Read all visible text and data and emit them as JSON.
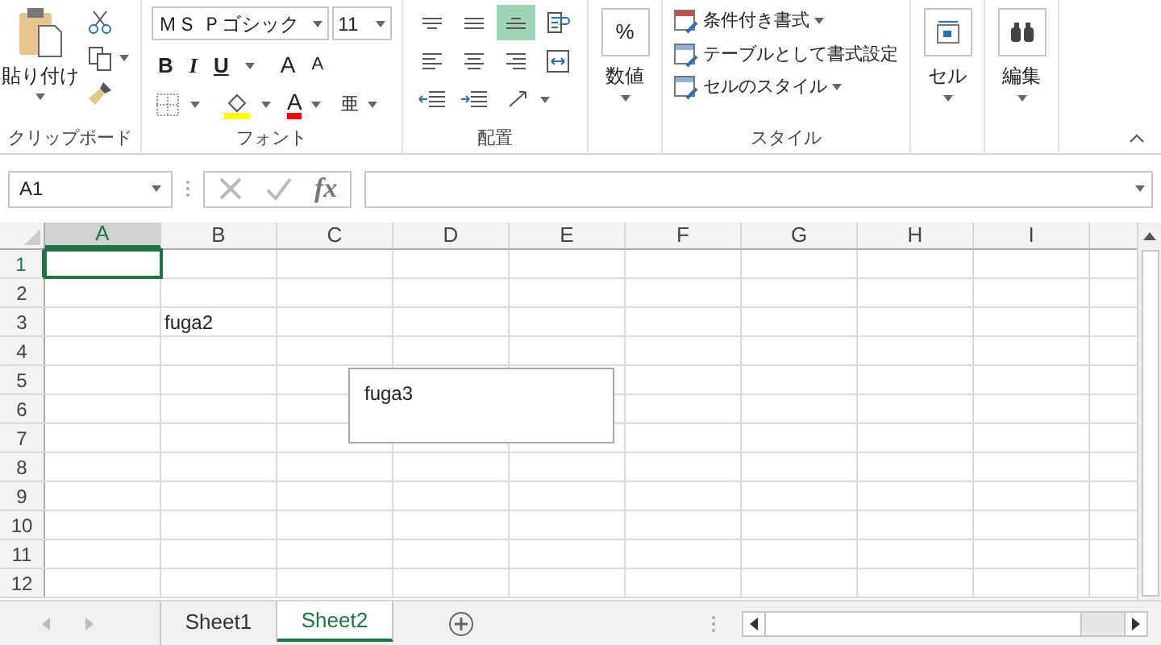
{
  "ribbon": {
    "clipboard": {
      "paste_label": "貼り付け",
      "group_label": "クリップボード"
    },
    "font": {
      "font_name": "ＭＳ Ｐゴシック",
      "font_size": "11",
      "bold": "B",
      "italic": "I",
      "underline": "U",
      "grow": "A",
      "shrink": "A",
      "font_color": "A",
      "phonetic": "亜",
      "group_label": "フォント"
    },
    "alignment": {
      "buttons": [
        {
          "kind": "top",
          "selected": false
        },
        {
          "kind": "middle",
          "selected": false
        },
        {
          "kind": "bottom",
          "selected": true
        },
        {
          "kind": "wrap",
          "selected": false
        },
        {
          "kind": "left",
          "selected": false
        },
        {
          "kind": "center",
          "selected": false
        },
        {
          "kind": "right",
          "selected": false
        },
        {
          "kind": "merge",
          "selected": false
        }
      ],
      "group_label": "配置"
    },
    "number": {
      "symbol": "%",
      "label": "数値"
    },
    "styles": {
      "items": [
        {
          "kind": "conditional",
          "label": "条件付き書式"
        },
        {
          "kind": "table",
          "label": "テーブルとして書式設定"
        },
        {
          "kind": "cell",
          "label": "セルのスタイル"
        }
      ],
      "group_label": "スタイル"
    },
    "cells": {
      "label": "セル"
    },
    "editing": {
      "label": "編集"
    }
  },
  "name_box": {
    "value": "A1"
  },
  "formula_bar": {
    "fx": "fx"
  },
  "columns": [
    {
      "label": "A",
      "selected": true
    },
    {
      "label": "B",
      "selected": false
    },
    {
      "label": "C",
      "selected": false
    },
    {
      "label": "D",
      "selected": false
    },
    {
      "label": "E",
      "selected": false
    },
    {
      "label": "F",
      "selected": false
    },
    {
      "label": "G",
      "selected": false
    },
    {
      "label": "H",
      "selected": false
    },
    {
      "label": "I",
      "selected": false
    }
  ],
  "rows": [
    {
      "label": "1",
      "selected": true
    },
    {
      "label": "2",
      "selected": false
    },
    {
      "label": "3",
      "selected": false,
      "cells": {
        "B": "fuga2"
      }
    },
    {
      "label": "4",
      "selected": false
    },
    {
      "label": "5",
      "selected": false
    },
    {
      "label": "6",
      "selected": false
    },
    {
      "label": "7",
      "selected": false
    },
    {
      "label": "8",
      "selected": false
    },
    {
      "label": "9",
      "selected": false
    },
    {
      "label": "10",
      "selected": false
    },
    {
      "label": "11",
      "selected": false
    },
    {
      "label": "12",
      "selected": false
    }
  ],
  "text_box": {
    "text": "fuga3"
  },
  "sheet_tabs": [
    {
      "label": "Sheet1",
      "selected": false
    },
    {
      "label": "Sheet2",
      "selected": true
    }
  ]
}
